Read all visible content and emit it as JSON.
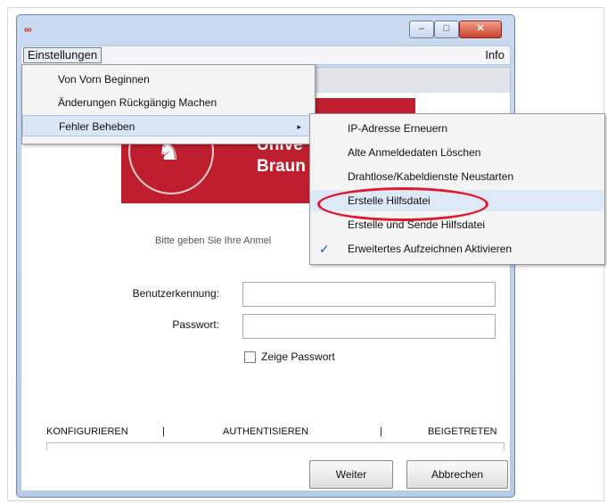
{
  "menubar": {
    "einstellungen": "Einstellungen",
    "info": "Info"
  },
  "window": {
    "app_icon": "∞",
    "min": "–",
    "max": "□",
    "close": "✕"
  },
  "menu1": {
    "items": [
      "Von Vorn Beginnen",
      "Änderungen Rückgängig Machen",
      "Fehler Beheben"
    ],
    "submenu_arrow": "▸"
  },
  "menu2": {
    "items": [
      "IP-Adresse Erneuern",
      "Alte Anmeldedaten Löschen",
      "Drahtlose/Kabeldienste Neustarten",
      "Erstelle Hilfsdatei",
      "Erstelle und Sende Hilfsdatei",
      "Erweitertes Aufzeichnen Aktivieren"
    ],
    "check_mark": "✓"
  },
  "banner": {
    "line1": "Unive",
    "line2": "Braun"
  },
  "form": {
    "prompt": "Bitte geben Sie Ihre Anmel",
    "user_label": "Benutzerkennung:",
    "pass_label": "Passwort:",
    "user_value": "",
    "pass_value": "",
    "show_password": "Zeige Passwort"
  },
  "steps": [
    "KONFIGURIEREN",
    "|",
    "AUTHENTISIEREN",
    "|",
    "BEIGETRETEN"
  ],
  "buttons": {
    "weiter": "Weiter",
    "abbrechen": "Abbrechen"
  },
  "colors": {
    "accent": "#be1e2d",
    "highlight_circle": "#e0182b",
    "menu_hover": "#d8e6f5"
  }
}
